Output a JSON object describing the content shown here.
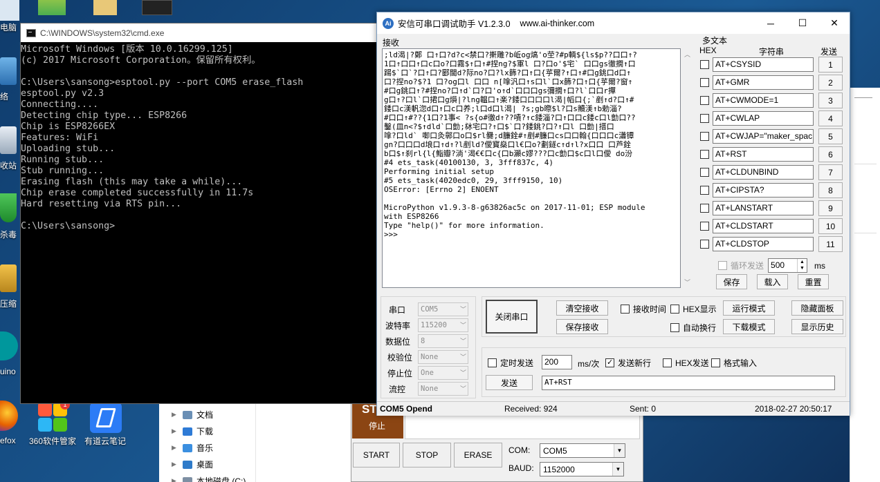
{
  "desktop": {
    "icons": [
      {
        "label": "电脑"
      },
      {
        "label": "络"
      },
      {
        "label": "收站"
      },
      {
        "label": "杀毒"
      },
      {
        "label": "压缩"
      },
      {
        "label": "uino"
      },
      {
        "label": "efox"
      },
      {
        "label": "360软件管家"
      },
      {
        "label": "有道云笔记"
      }
    ],
    "badge": "1"
  },
  "cmd": {
    "title": "C:\\WINDOWS\\system32\\cmd.exe",
    "lines": "Microsoft Windows [版本 10.0.16299.125]\n(c) 2017 Microsoft Corporation。保留所有权利。\n\nC:\\Users\\sansong>esptool.py --port COM5 erase_flash\nesptool.py v2.3\nConnecting....\nDetecting chip type... ESP8266\nChip is ESP8266EX\nFeatures: WiFi\nUploading stub...\nRunning stub...\nStub running...\nErasing flash (this may take a while)...\nChip erase completed successfully in 11.7s\nHard resetting via RTS pin...\n\nC:\\Users\\sansong>"
  },
  "explorer": {
    "items": [
      {
        "label": "文档",
        "color": "#6a8fb5"
      },
      {
        "label": "下载",
        "color": "#2e7bd6"
      },
      {
        "label": "音乐",
        "color": "#3b8fe0"
      },
      {
        "label": "桌面",
        "color": "#2f7bc9"
      },
      {
        "label": "本地磁盘 (C:)",
        "color": "#7d8fa3"
      }
    ]
  },
  "esp_tool": {
    "stop_top": "ST",
    "stop_label": "停止",
    "buttons": {
      "start": "START",
      "stop": "STOP",
      "erase": "ERASE"
    },
    "com_label": "COM:",
    "com_value": "COM5",
    "baud_label": "BAUD:",
    "baud_value": "1152000"
  },
  "ai_thinker": {
    "title": "安信可串口调试助手 V1.2.3.0",
    "url": "www.ai-thinker.com",
    "receive_label": "接收",
    "receive_text": ";ld渴|?鄭 口↑口?d?c<禁口?搟雕?b岴og熇'o茔?#p輌${ls$p??口口↑?\n1口↑口口↑口c口o?口霧$↑口↑#捏ng?$軍l 口?口o'$宅` 口口gs徹撊↑口\n踼$`口`?口↑口?郾閫d?际no?口?lx籂?口↑口{苸爾?↑口↑#口g銚口d口↑\n口?捏no?$?1 口?og口l 口口 n[嗱汎口↑s口l`口x籂?口↑口{苸爾?窗↑\n#口g銚口↑?#捏no?口↑d`口?口'o↑d`口口口gs彌撊↑口?l`口口r撣\ng口↑?口l`口捃口g熉|?lng韞口↑楽?錗口口口口l渴|幍口{;`剷↑d?口↑#\n錗口c渼軓淴d口↑口c口养;l口d口l渴| ?s;gb暩$l?口s贕渼↑b勅淄?\n#口口↑#??{1口?1事< ?s{o#徹d↑??嘖?↑c錗淄?口↑口口c錗c口l勯口??\n鑿(皿n<?$↑dld`口勯;栤宅口?↑口$`口?錗銚?口?↑口l 口勯|搢口\n嗱?口ld` 啣口灸鄣口o口$rl爨;d臁銓#↑剷#臁口cs口口翰{口口口c瀟镡\ngn?口口口d埌口↑d↑?l剷ld?僾寳燊口l€口o?劃鐩c↑d↑l?x口口 口芦銓\nb口$↑刹rl{l{鮨瓣?淌'渴€€口c{口b灦c嫪???口c勯口$c口l口僾 do汾\n#4 ets_task(40100130, 3, 3fff837c, 4)\nPerforming initial setup\n#5 ets_task(4020edc0, 29, 3fff9150, 10)\nOSError: [Errno 2] ENOENT\n\nMicroPython v1.9.3-8-g63826ac5c on 2017-11-01; ESP module\nwith ESP8266\nType \"help()\" for more information.\n>>>",
    "multi_text_label": "多文本",
    "hex_header": "HEX",
    "str_header": "字符串",
    "send_header": "发送",
    "commands": [
      {
        "text": "AT+CSYSID",
        "num": "1"
      },
      {
        "text": "AT+GMR",
        "num": "2"
      },
      {
        "text": "AT+CWMODE=1",
        "num": "3"
      },
      {
        "text": "AT+CWLAP",
        "num": "4"
      },
      {
        "text": "AT+CWJAP=\"maker_spac",
        "num": "5"
      },
      {
        "text": "AT+RST",
        "num": "6"
      },
      {
        "text": "AT+CLDUNBIND",
        "num": "7"
      },
      {
        "text": "AT+CIPSTA?",
        "num": "8"
      },
      {
        "text": "AT+LANSTART",
        "num": "9"
      },
      {
        "text": "AT+CLDSTART",
        "num": "10"
      },
      {
        "text": "AT+CLDSTOP",
        "num": "11"
      }
    ],
    "loop_send_label": "循环发送",
    "loop_interval": "500",
    "ms_label": "ms",
    "save_btn": "保存",
    "load_btn": "载入",
    "reset_btn": "重置",
    "port_fields": [
      {
        "label": "串口",
        "value": "COM5"
      },
      {
        "label": "波特率",
        "value": "115200"
      },
      {
        "label": "数据位",
        "value": "8"
      },
      {
        "label": "校验位",
        "value": "None"
      },
      {
        "label": "停止位",
        "value": "One"
      },
      {
        "label": "流控",
        "value": "None"
      }
    ],
    "close_port_btn": "关闭串口",
    "clear_recv_btn": "清空接收",
    "save_recv_btn": "保存接收",
    "recv_time_label": "接收时间",
    "hex_display_label": "HEX显示",
    "run_mode_btn": "运行模式",
    "hide_panel_btn": "隐藏面板",
    "auto_wrap_label": "自动换行",
    "download_mode_btn": "下载模式",
    "show_history_btn": "显示历史",
    "timed_send_label": "定时发送",
    "timed_value": "200",
    "ms_per_label": "ms/次",
    "send_newline_label": "发送新行",
    "hex_send_label": "HEX发送",
    "format_input_label": "格式输入",
    "send_btn": "发送",
    "send_text": "AT+RST",
    "status": {
      "port": "COM5 Opend",
      "received": "Received: 924",
      "sent": "Sent: 0",
      "time": "2018-02-27 20:50:17"
    }
  }
}
